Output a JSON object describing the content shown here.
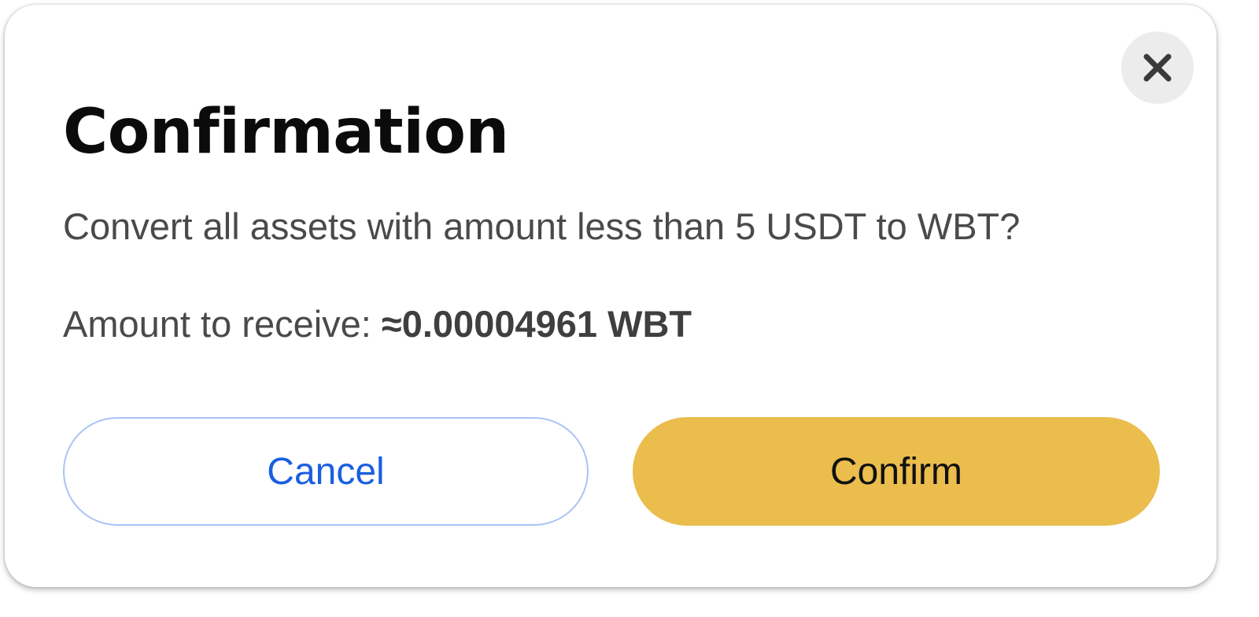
{
  "dialog": {
    "title": "Confirmation",
    "message": "Convert all assets with amount less than 5 USDT to WBT?",
    "receive_label": "Amount to receive:",
    "receive_amount": "≈0.00004961 WBT",
    "close_icon": "close-icon",
    "cancel_label": "Cancel",
    "confirm_label": "Confirm"
  },
  "colors": {
    "confirm_button_bg": "#eabd4d",
    "cancel_button_text": "#1a5fe0",
    "cancel_button_border": "#a9c4f5",
    "close_button_bg": "#ececec"
  }
}
